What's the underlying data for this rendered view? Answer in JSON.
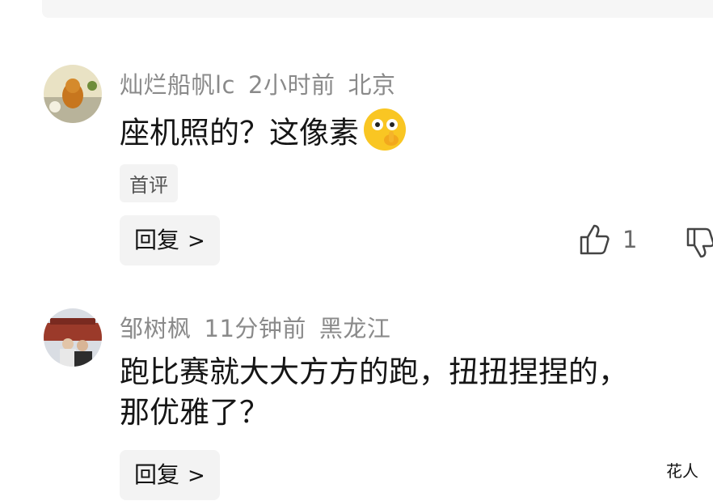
{
  "comments": [
    {
      "username": "灿烂船帆lc",
      "time": "2小时前",
      "location": "北京",
      "text": "座机照的？这像素",
      "emoji_icon": "face-with-hand-over-mouth-emoji",
      "tag": "首评",
      "reply_label": "回复",
      "like_count": "1"
    },
    {
      "username": "邹树枫",
      "time": "11分钟前",
      "location": "黑龙江",
      "text_line1": "跑比赛就大大方方的跑，扭扭捏捏的，",
      "text_line2": "那优雅了？",
      "reply_label": "回复"
    }
  ],
  "watermark": "花人"
}
